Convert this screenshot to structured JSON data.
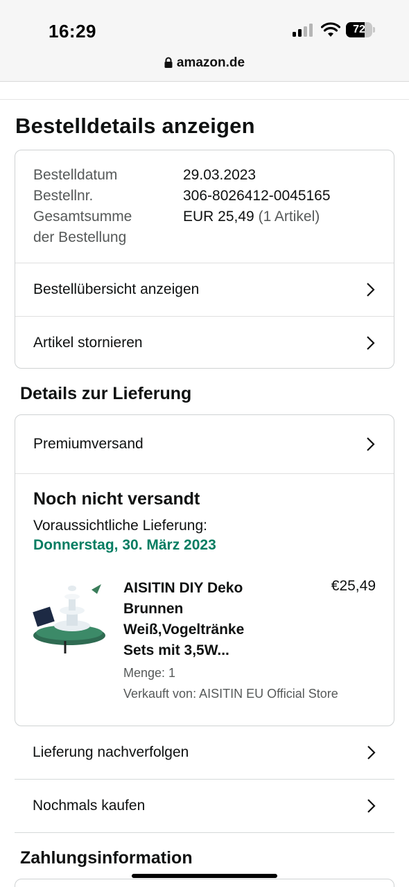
{
  "status_bar": {
    "time": "16:29",
    "battery": "72",
    "battery_fraction": 0.72
  },
  "browser": {
    "domain": "amazon.de"
  },
  "page": {
    "title": "Bestelldetails anzeigen"
  },
  "order_summary": {
    "rows": [
      {
        "key": "Bestelldatum",
        "value": "29.03.2023"
      },
      {
        "key": "Bestellnr.",
        "value": "306-8026412-0045165"
      }
    ],
    "total_key_line1": "Gesamtsumme",
    "total_key_line2": "der Bestellung",
    "total_value": "EUR 25,49",
    "total_items": "(1 Artikel)",
    "actions": [
      {
        "label": "Bestellübersicht anzeigen"
      },
      {
        "label": "Artikel stornieren"
      }
    ]
  },
  "delivery": {
    "section_title": "Details zur Lieferung",
    "shipping_method": "Premiumversand",
    "status": "Noch nicht versandt",
    "eta_label": "Voraussichtliche Lieferung:",
    "eta_date": "Donnerstag, 30. März 2023",
    "item": {
      "title": "AISITIN DIY Deko Brunnen Weiß,Vogeltränke Sets mit 3,5W...",
      "price": "€25,49",
      "quantity": "Menge: 1",
      "seller": "Verkauft von: AISITIN EU Official Store"
    },
    "actions": [
      {
        "label": "Lieferung nachverfolgen"
      },
      {
        "label": "Nochmals kaufen"
      }
    ]
  },
  "payment": {
    "section_title": "Zahlungsinformation"
  },
  "colors": {
    "eta_green": "#067d62",
    "muted_text": "#565959",
    "border": "#cfd2d3"
  }
}
